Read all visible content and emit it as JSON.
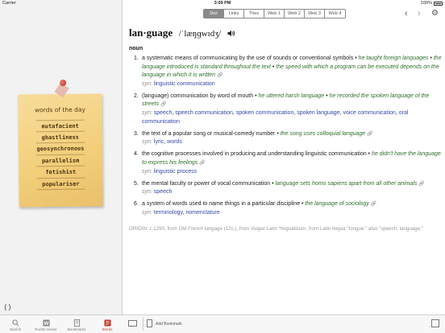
{
  "status": {
    "carrier": "Carrier",
    "time": "3:09 PM",
    "battery": "100%"
  },
  "sidebar": {
    "note_title": "words of the day",
    "words": [
      "mutafacient",
      "ghastliness",
      "geosynchronous",
      "parallelism",
      "fetishist",
      "populariser"
    ],
    "expand_label": "⟨⟩"
  },
  "tabs": [
    {
      "label": "Search",
      "icon": "search-icon"
    },
    {
      "label": "Puzzle Solver",
      "icon": "puzzle-icon"
    },
    {
      "label": "Bookmarks",
      "icon": "bookmark-icon"
    },
    {
      "label": "Words",
      "icon": "words-icon",
      "active": true
    }
  ],
  "toolbar": {
    "segments": [
      "Dict",
      "Links",
      "Thes",
      "Web 1",
      "Web 2",
      "Web 3",
      "Web 4"
    ],
    "active_segment": "Dict"
  },
  "entry": {
    "headword": "lan·guage",
    "pronunciation": "/ˈlæŋɡwɪdʒ/",
    "pos": "noun",
    "senses": [
      {
        "num": "1.",
        "def": "a systematic means of communicating by the use of sounds or conventional symbols",
        "examples": [
          "he taught foreign languages",
          "the language introduced is standard throughout the text",
          "the speed with which a program can be executed depends on the language in which it is written"
        ],
        "syn": [
          "linguistic communication"
        ]
      },
      {
        "num": "2.",
        "def": "(language) communication by word of mouth",
        "examples": [
          "he uttered harsh language",
          "he recorded the spoken language of the streets"
        ],
        "syn": [
          "speech",
          "speech communication",
          "spoken communication",
          "spoken language",
          "voice communication",
          "oral communication"
        ]
      },
      {
        "num": "3.",
        "def": "the text of a popular song or musical-comedy number",
        "examples": [
          "the song uses colloquial language"
        ],
        "syn": [
          "lyric",
          "words"
        ]
      },
      {
        "num": "4.",
        "def": "the cognitive processes involved in producing and understanding linguistic communication",
        "examples": [
          "he didn't have the language to express his feelings"
        ],
        "syn": [
          "linguistic process"
        ]
      },
      {
        "num": "5.",
        "def": "the mental faculty or power of vocal communication",
        "examples": [
          "language sets homo sapiens apart from all other animals"
        ],
        "syn": [
          "speech"
        ]
      },
      {
        "num": "6.",
        "def": "a system of words used to name things in a particular discipline",
        "examples": [
          "the language of sociology"
        ],
        "syn": [
          "terminology",
          "nomenclature"
        ]
      }
    ],
    "origin": {
      "lead": "ORIGIN: c.1290, from",
      "lang1": "Old French",
      "mid1": "langage (12c.), from",
      "lang2": "Vulgar Latin",
      "tail": "*linguaticum, from Latin lingua \"tongue.\" also \"speech, language.\""
    }
  },
  "bottombar": {
    "add_bookmark": "Add Bookmark"
  },
  "colors": {
    "accent": "#c0392b",
    "example": "#2f6f2a",
    "synonym": "#3448a8"
  }
}
